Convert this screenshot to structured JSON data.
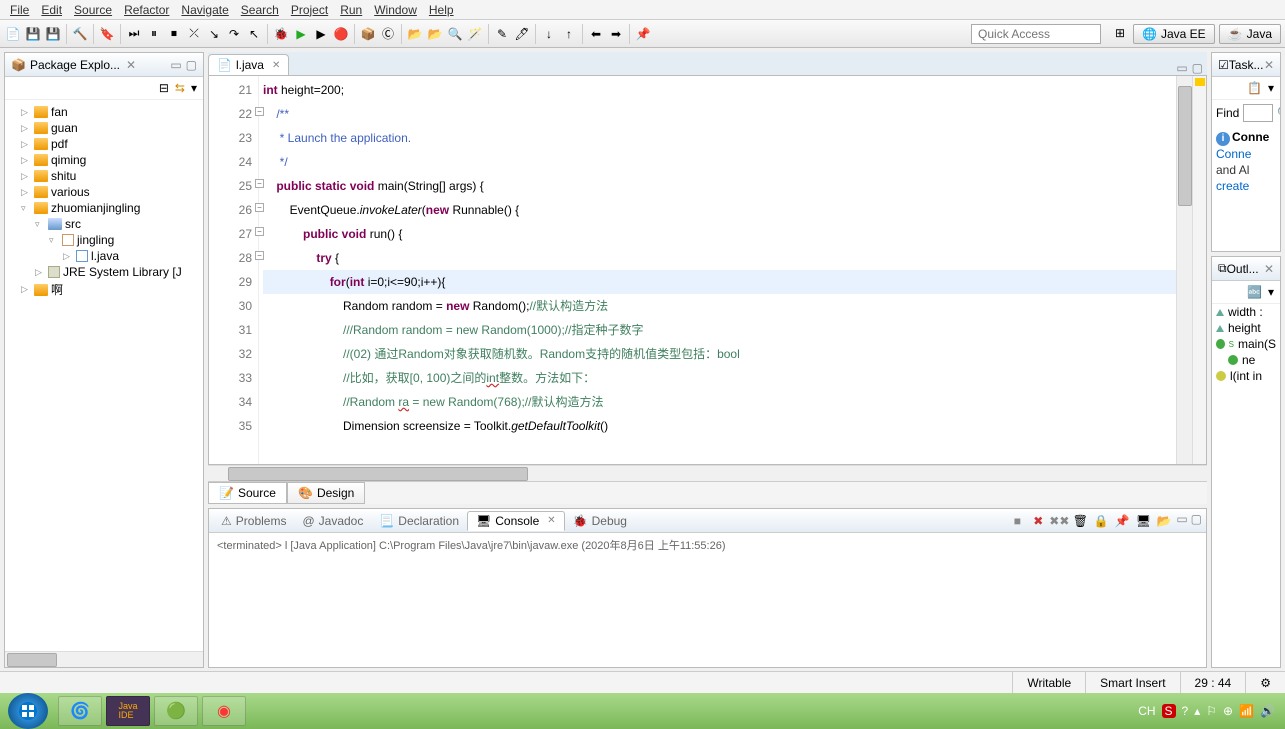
{
  "menus": [
    "File",
    "Edit",
    "Source",
    "Refactor",
    "Navigate",
    "Search",
    "Project",
    "Run",
    "Window",
    "Help"
  ],
  "quick_access_placeholder": "Quick Access",
  "perspectives": [
    {
      "label": "Java EE",
      "icon": "globe-icon"
    },
    {
      "label": "Java",
      "icon": "java-icon"
    }
  ],
  "package_explorer": {
    "title": "Package Explo...",
    "items": [
      {
        "label": "fan",
        "depth": 1,
        "icon": "folder",
        "expand": "▷"
      },
      {
        "label": "guan",
        "depth": 1,
        "icon": "folder",
        "expand": "▷"
      },
      {
        "label": "pdf",
        "depth": 1,
        "icon": "folder",
        "expand": "▷"
      },
      {
        "label": "qiming",
        "depth": 1,
        "icon": "folder",
        "expand": "▷"
      },
      {
        "label": "shitu",
        "depth": 1,
        "icon": "folder",
        "expand": "▷"
      },
      {
        "label": "various",
        "depth": 1,
        "icon": "folder",
        "expand": "▷"
      },
      {
        "label": "zhuomianjingling",
        "depth": 1,
        "icon": "folder",
        "expand": "▿"
      },
      {
        "label": "src",
        "depth": 2,
        "icon": "src",
        "expand": "▿"
      },
      {
        "label": "jingling",
        "depth": 3,
        "icon": "pkg",
        "expand": "▿"
      },
      {
        "label": "l.java",
        "depth": 4,
        "icon": "java",
        "expand": "▷"
      },
      {
        "label": "JRE System Library [J",
        "depth": 2,
        "icon": "lib",
        "expand": "▷"
      },
      {
        "label": "啊",
        "depth": 1,
        "icon": "folder",
        "expand": "▷"
      }
    ]
  },
  "editor": {
    "tab_label": "l.java",
    "lines_start": 21,
    "highlighted_line": 29,
    "code_lines": [
      {
        "n": 21,
        "html": "<span class='kw'>int</span> height=200;"
      },
      {
        "n": 22,
        "html": "    <span class='doc'>/**</span>",
        "fold": true
      },
      {
        "n": 23,
        "html": "     <span class='doc'>* Launch the application.</span>"
      },
      {
        "n": 24,
        "html": "     <span class='doc'>*/</span>"
      },
      {
        "n": 25,
        "html": "    <span class='kw'>public static void</span> main(String[] args) {",
        "fold": true
      },
      {
        "n": 26,
        "html": "        EventQueue.<span class='ita'>invokeLater</span>(<span class='kw'>new</span> Runnable() {",
        "fold": true
      },
      {
        "n": 27,
        "html": "            <span class='kw'>public void</span> run() {",
        "fold": true
      },
      {
        "n": 28,
        "html": "                <span class='kw'>try</span> {",
        "fold": true
      },
      {
        "n": 29,
        "html": "                    <span class='kw'>for</span>(<span class='kw'>int</span> i=0;i&lt;=90;i++){",
        "hl": true
      },
      {
        "n": 30,
        "html": "                        Random random = <span class='kw'>new</span> Random();<span class='com'>//默认构造方法</span>"
      },
      {
        "n": 31,
        "html": "                        <span class='com'>///Random random = new Random(1000);//指定种子数字</span>"
      },
      {
        "n": 32,
        "html": "                        <span class='com'>//(02) 通过Random对象获取随机数。Random支持的随机值类型包括：bool</span>"
      },
      {
        "n": 33,
        "html": "                        <span class='com'>//比如，获取[0, 100)之间的<span style='text-decoration:underline wavy #c33'>int</span>整数。方法如下：</span>"
      },
      {
        "n": 34,
        "html": "                        <span class='com'>//Random <span style='text-decoration:underline wavy #c33'>ra</span> = new Random(768);//默认构造方法</span>"
      },
      {
        "n": 35,
        "html": "                        Dimension screensize = Toolkit.<span class='ita'>getDefaultToolkit</span>()"
      }
    ],
    "source_tab": "Source",
    "design_tab": "Design"
  },
  "bottom": {
    "tabs": [
      "Problems",
      "Javadoc",
      "Declaration",
      "Console",
      "Debug"
    ],
    "active_tab": "Console",
    "console_line": "<terminated> l [Java Application] C:\\Program Files\\Java\\jre7\\bin\\javaw.exe (2020年8月6日 上午11:55:26)"
  },
  "tasks": {
    "title": "Task..."
  },
  "find_label": "Find",
  "connect": {
    "title": "Conne",
    "links": [
      "Conne",
      "and Al",
      "create"
    ]
  },
  "outline": {
    "title": "Outl...",
    "items": [
      {
        "icon": "tri",
        "label": "width :"
      },
      {
        "icon": "tri",
        "label": "height"
      },
      {
        "icon": "grn",
        "label": "main(S",
        "sup": "S"
      },
      {
        "icon": "grn",
        "label": "ne",
        "sub": true
      },
      {
        "icon": "yel",
        "label": "l(int in"
      }
    ]
  },
  "status": {
    "writable": "Writable",
    "insert": "Smart Insert",
    "pos": "29 : 44"
  },
  "tray": {
    "ime": "CH",
    "icons": [
      "S",
      "?",
      "^"
    ],
    "flag": "▲"
  }
}
